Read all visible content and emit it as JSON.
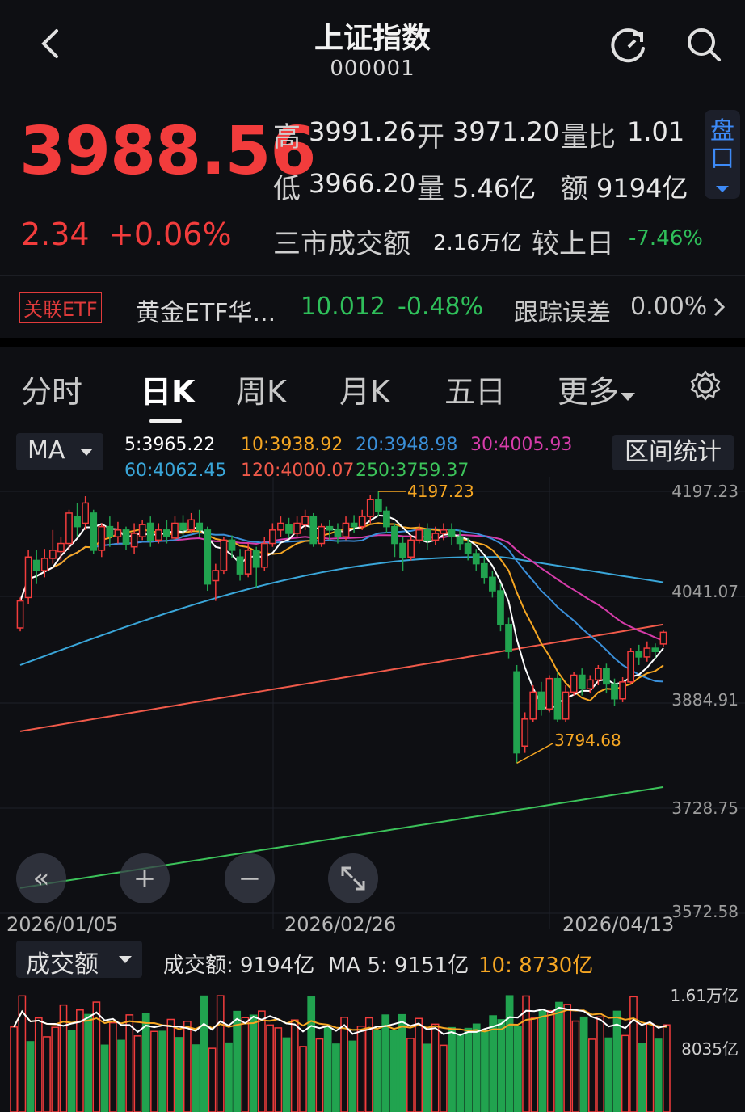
{
  "header": {
    "title": "上证指数",
    "code": "000001",
    "back_icon": "chevron-left-icon",
    "refresh_icon": "refresh-icon",
    "search_icon": "search-icon"
  },
  "quote": {
    "price": "3988.56",
    "change": "2.34",
    "change_pct": "+0.06%",
    "high_label": "高",
    "high": "3991.26",
    "open_label": "开",
    "open": "3971.20",
    "vol_ratio_label": "量比",
    "vol_ratio": "1.01",
    "low_label": "低",
    "low": "3966.20",
    "vol_label": "量",
    "vol": "5.46亿",
    "amount_label": "额",
    "amount": "9194亿",
    "market_amount_label": "三市成交额",
    "market_amount": "2.16万亿",
    "vs_prev_label": "较上日",
    "vs_prev": "-7.46%",
    "pankou_label": "盘口"
  },
  "etf": {
    "tag": "关联ETF",
    "name": "黄金ETF华...",
    "price": "10.012",
    "change": "-0.48%",
    "tracking_label": "跟踪误差",
    "tracking": "0.00%"
  },
  "tabs": [
    "分时",
    "日K",
    "周K",
    "月K",
    "五日",
    "更多"
  ],
  "ma": {
    "selector": "MA",
    "ma5": "5:3965.22",
    "ma10": "10:3938.92",
    "ma20": "20:3948.98",
    "ma30": "30:4005.93",
    "ma60": "60:4062.45",
    "ma120": "120:4000.07",
    "ma250": "250:3759.37",
    "stats_button": "区间统计"
  },
  "chart_data": {
    "type": "candlestick",
    "y_ticks": [
      "4197.23",
      "4041.07",
      "3884.91",
      "3728.75",
      "3572.58"
    ],
    "ylim": [
      3572.58,
      4197.23
    ],
    "x_ticks": [
      "2026/01/05",
      "2026/02/26",
      "2026/04/13"
    ],
    "annotations": {
      "high": "4197.23",
      "low": "3794.68"
    },
    "candles": [
      [
        3995,
        4035,
        3990,
        4040
      ],
      [
        4040,
        4100,
        4030,
        4110
      ],
      [
        4095,
        4080,
        4060,
        4110
      ],
      [
        4080,
        4098,
        4070,
        4112
      ],
      [
        4098,
        4110,
        4090,
        4140
      ],
      [
        4108,
        4120,
        4095,
        4130
      ],
      [
        4120,
        4165,
        4110,
        4170
      ],
      [
        4160,
        4145,
        4130,
        4180
      ],
      [
        4150,
        4180,
        4140,
        4190
      ],
      [
        4165,
        4110,
        4105,
        4170
      ],
      [
        4110,
        4145,
        4100,
        4150
      ],
      [
        4145,
        4130,
        4115,
        4160
      ],
      [
        4130,
        4140,
        4120,
        4152
      ],
      [
        4140,
        4118,
        4110,
        4145
      ],
      [
        4115,
        4135,
        4105,
        4150
      ],
      [
        4130,
        4148,
        4125,
        4155
      ],
      [
        4150,
        4125,
        4115,
        4160
      ],
      [
        4125,
        4140,
        4120,
        4150
      ],
      [
        4140,
        4130,
        4120,
        4155
      ],
      [
        4128,
        4150,
        4125,
        4160
      ],
      [
        4150,
        4140,
        4130,
        4162
      ],
      [
        4140,
        4155,
        4135,
        4165
      ],
      [
        4150,
        4140,
        4130,
        4170
      ],
      [
        4140,
        4060,
        4050,
        4145
      ],
      [
        4065,
        4080,
        4035,
        4090
      ],
      [
        4080,
        4125,
        4075,
        4130
      ],
      [
        4125,
        4110,
        4098,
        4132
      ],
      [
        4100,
        4075,
        4065,
        4112
      ],
      [
        4075,
        4110,
        4070,
        4120
      ],
      [
        4110,
        4085,
        4055,
        4115
      ],
      [
        4085,
        4120,
        4080,
        4130
      ],
      [
        4120,
        4140,
        4115,
        4150
      ],
      [
        4140,
        4150,
        4130,
        4160
      ],
      [
        4148,
        4135,
        4128,
        4158
      ],
      [
        4135,
        4150,
        4130,
        4160
      ],
      [
        4148,
        4160,
        4140,
        4170
      ],
      [
        4160,
        4120,
        4115,
        4165
      ],
      [
        4120,
        4145,
        4115,
        4150
      ],
      [
        4145,
        4140,
        4125,
        4155
      ],
      [
        4140,
        4130,
        4120,
        4150
      ],
      [
        4130,
        4150,
        4125,
        4160
      ],
      [
        4150,
        4145,
        4135,
        4162
      ],
      [
        4145,
        4160,
        4140,
        4170
      ],
      [
        4160,
        4185,
        4150,
        4192
      ],
      [
        4185,
        4168,
        4160,
        4197.23
      ],
      [
        4168,
        4145,
        4135,
        4175
      ],
      [
        4145,
        4120,
        4100,
        4150
      ],
      [
        4120,
        4100,
        4080,
        4130
      ],
      [
        4100,
        4125,
        4095,
        4132
      ],
      [
        4125,
        4140,
        4120,
        4150
      ],
      [
        4140,
        4125,
        4110,
        4150
      ],
      [
        4125,
        4135,
        4118,
        4145
      ],
      [
        4135,
        4140,
        4125,
        4150
      ],
      [
        4140,
        4130,
        4118,
        4150
      ],
      [
        4130,
        4120,
        4110,
        4140
      ],
      [
        4120,
        4105,
        4095,
        4128
      ],
      [
        4105,
        4090,
        4080,
        4112
      ],
      [
        4090,
        4070,
        4060,
        4100
      ],
      [
        4070,
        4050,
        4040,
        4080
      ],
      [
        4050,
        4000,
        3990,
        4060
      ],
      [
        4000,
        3960,
        3950,
        4010
      ],
      [
        3930,
        3810,
        3794.68,
        3940
      ],
      [
        3820,
        3860,
        3810,
        3870
      ],
      [
        3860,
        3900,
        3855,
        3910
      ],
      [
        3900,
        3875,
        3865,
        3915
      ],
      [
        3875,
        3920,
        3870,
        3925
      ],
      [
        3920,
        3860,
        3855,
        3930
      ],
      [
        3860,
        3900,
        3855,
        3910
      ],
      [
        3900,
        3925,
        3895,
        3930
      ],
      [
        3925,
        3905,
        3895,
        3935
      ],
      [
        3905,
        3918,
        3898,
        3925
      ],
      [
        3918,
        3935,
        3910,
        3940
      ],
      [
        3935,
        3912,
        3898,
        3942
      ],
      [
        3912,
        3890,
        3880,
        3920
      ],
      [
        3890,
        3915,
        3885,
        3922
      ],
      [
        3915,
        3960,
        3912,
        3965
      ],
      [
        3960,
        3952,
        3940,
        3970
      ],
      [
        3952,
        3965,
        3945,
        3975
      ],
      [
        3965,
        3960,
        3950,
        3972
      ],
      [
        3971.2,
        3988.56,
        3966.2,
        3991.26
      ]
    ]
  },
  "chart_controls": {
    "rewind": "«",
    "zoom_in": "+",
    "zoom_out": "−",
    "expand_icon": "expand-icon"
  },
  "volume": {
    "selector": "成交额",
    "amount": "成交额: 9194亿",
    "ma5": "MA 5: 9151亿",
    "ma10": "10: 8730亿",
    "y_ticks": [
      "1.61万亿",
      "8035亿"
    ]
  },
  "colors": {
    "up": "#f23c3c",
    "down": "#21a34f",
    "accent_blue": "#3d8af7",
    "bg": "#0e0f13",
    "ma5": "#ffffff",
    "ma10": "#f5a623",
    "ma20": "#3a8fd9",
    "ma30": "#d63caa",
    "ma60": "#3aa6d9",
    "ma120": "#f05a4a",
    "ma250": "#3cc25a"
  }
}
